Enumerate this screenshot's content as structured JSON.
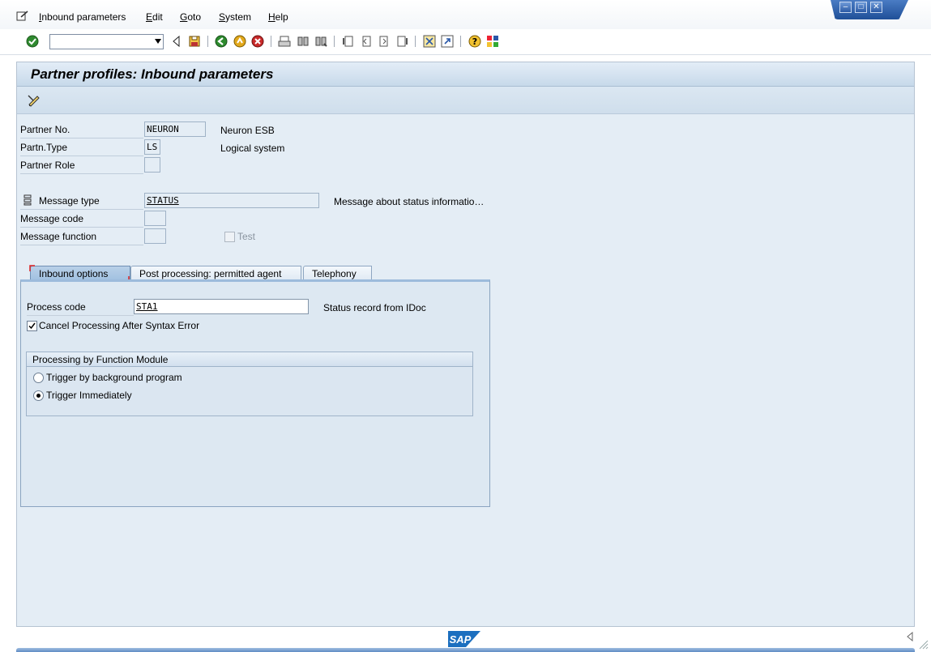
{
  "menu": {
    "items": [
      {
        "u": "I",
        "rest": "nbound parameters"
      },
      {
        "u": "E",
        "rest": "dit"
      },
      {
        "u": "G",
        "rest": "oto"
      },
      {
        "u": "S",
        "rest": "ystem"
      },
      {
        "u": "H",
        "rest": "elp"
      }
    ]
  },
  "toolbar": {
    "command_value": ""
  },
  "page": {
    "title": "Partner profiles: Inbound parameters"
  },
  "header_fields": {
    "partner_no": {
      "label": "Partner No.",
      "value": "NEURON",
      "desc": "Neuron ESB"
    },
    "partner_type": {
      "label": "Partn.Type",
      "value": "LS",
      "desc": "Logical system"
    },
    "partner_role": {
      "label": "Partner Role",
      "value": ""
    },
    "message_type": {
      "label": "Message type",
      "value": "STATUS",
      "desc": "Message about status informatio…"
    },
    "message_code": {
      "label": "Message code",
      "value": ""
    },
    "message_function": {
      "label": "Message function",
      "value": ""
    },
    "test": {
      "label": "Test"
    }
  },
  "tabs": [
    {
      "label": "Inbound options"
    },
    {
      "label": "Post processing: permitted agent"
    },
    {
      "label": "Telephony"
    }
  ],
  "inbound": {
    "process_code": {
      "label": "Process code",
      "value": "STA1",
      "desc": "Status record from IDoc"
    },
    "cancel_processing": {
      "label": "Cancel Processing After Syntax Error",
      "checked": true
    },
    "group_title": "Processing by Function Module",
    "options": [
      {
        "label": "Trigger by background program",
        "selected": false
      },
      {
        "label": "Trigger Immediately",
        "selected": true
      }
    ]
  },
  "status": {
    "logo_text": "SAP"
  },
  "colors": {
    "frame_bg": "#e4edf5",
    "title_gradient_top": "#e3edf7",
    "title_gradient_bottom": "#c7d9ea",
    "brand_blue": "#1f4f98"
  }
}
